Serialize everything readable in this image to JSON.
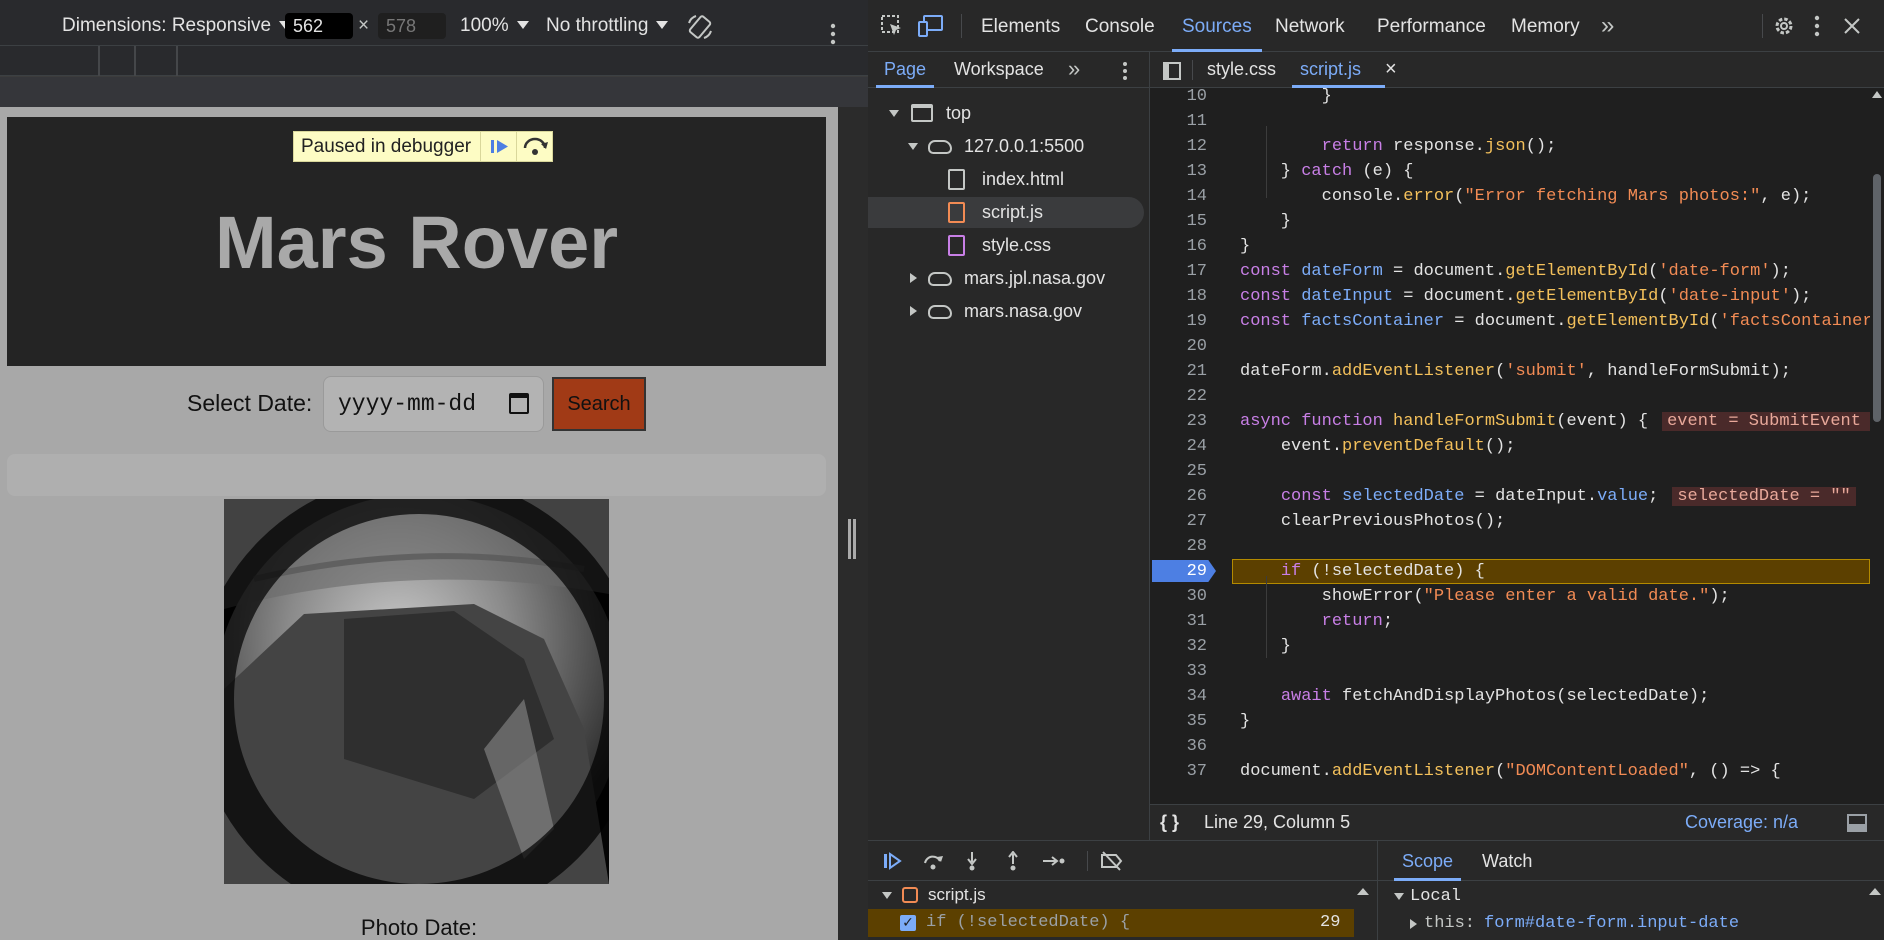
{
  "emulation": {
    "dimensions_label": "Dimensions: Responsive",
    "width": "562",
    "height": "578",
    "times": "×",
    "zoom": "100%",
    "throttling": "No throttling"
  },
  "site": {
    "paused_label": "Paused in debugger",
    "title": "Mars Rover",
    "select_date_label": "Select Date:",
    "date_placeholder": "yyyy-mm-dd",
    "search_label": "Search",
    "photo_date_label": "Photo Date:"
  },
  "devtools": {
    "tabs": [
      "Elements",
      "Console",
      "Sources",
      "Network",
      "Performance",
      "Memory"
    ],
    "active_tab": "Sources",
    "more_tabs": "»",
    "accent": "#7cacf8",
    "navigator": {
      "tabs": [
        "Page",
        "Workspace"
      ],
      "tree": {
        "top": "top",
        "host": "127.0.0.1:5500",
        "files": [
          "index.html",
          "script.js",
          "style.css"
        ],
        "domains": [
          "mars.jpl.nasa.gov",
          "mars.nasa.gov"
        ]
      }
    },
    "editor": {
      "tabs": [
        "style.css",
        "script.js"
      ],
      "active_tab": "script.js",
      "close_glyph": "×",
      "breakpoint_line": "29",
      "inline_values": {
        "event": "event = SubmitEvent {",
        "selectedDate": "selectedDate = \"\""
      },
      "lines": [
        {
          "n": "10",
          "t": "        }"
        },
        {
          "n": "11",
          "t": ""
        },
        {
          "n": "12",
          "t": "        return response.json();"
        },
        {
          "n": "13",
          "t": "    } catch (e) {"
        },
        {
          "n": "14",
          "t": "        console.error(\"Error fetching Mars photos:\", e);"
        },
        {
          "n": "15",
          "t": "    }"
        },
        {
          "n": "16",
          "t": "}"
        },
        {
          "n": "17",
          "t": "const dateForm = document.getElementById('date-form');"
        },
        {
          "n": "18",
          "t": "const dateInput = document.getElementById('date-input');"
        },
        {
          "n": "19",
          "t": "const factsContainer = document.getElementById('factsContainer'"
        },
        {
          "n": "20",
          "t": ""
        },
        {
          "n": "21",
          "t": "dateForm.addEventListener('submit', handleFormSubmit);"
        },
        {
          "n": "22",
          "t": ""
        },
        {
          "n": "23",
          "t": "async function handleFormSubmit(event) {"
        },
        {
          "n": "24",
          "t": "    event.preventDefault();"
        },
        {
          "n": "25",
          "t": ""
        },
        {
          "n": "26",
          "t": "    const selectedDate = dateInput.value;"
        },
        {
          "n": "27",
          "t": "    clearPreviousPhotos();"
        },
        {
          "n": "28",
          "t": ""
        },
        {
          "n": "29",
          "t": "    if (!selectedDate) {"
        },
        {
          "n": "30",
          "t": "        showError(\"Please enter a valid date.\");"
        },
        {
          "n": "31",
          "t": "        return;"
        },
        {
          "n": "32",
          "t": "    }"
        },
        {
          "n": "33",
          "t": ""
        },
        {
          "n": "34",
          "t": "    await fetchAndDisplayPhotos(selectedDate);"
        },
        {
          "n": "35",
          "t": "}"
        },
        {
          "n": "36",
          "t": ""
        },
        {
          "n": "37",
          "t": "document.addEventListener(\"DOMContentLoaded\", () => {"
        }
      ]
    },
    "status": {
      "format_icon": "{ }",
      "position": "Line 29, Column 5",
      "coverage": "Coverage: n/a"
    },
    "breakpoints": {
      "file": "script.js",
      "item_text": "if (!selectedDate) {",
      "item_line": "29"
    },
    "scope": {
      "tabs": [
        "Scope",
        "Watch"
      ],
      "local_label": "Local",
      "this_key": "this:",
      "this_value": "form#date-form.input-date"
    }
  }
}
